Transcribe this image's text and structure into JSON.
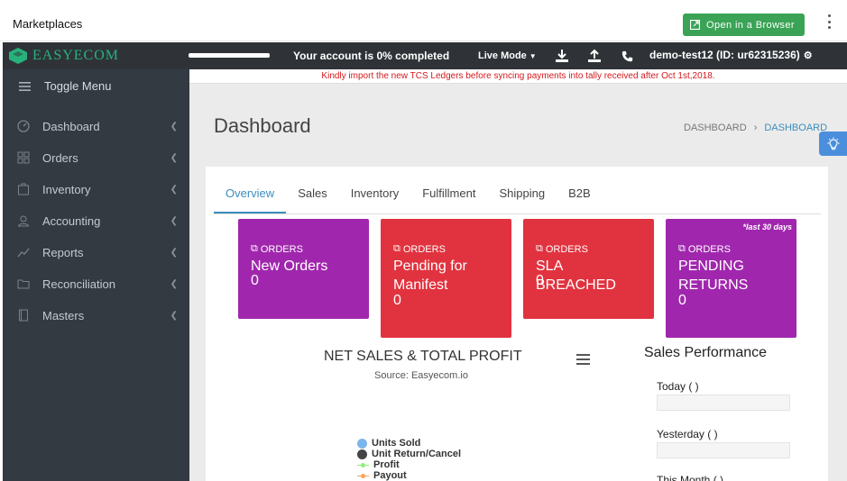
{
  "outer": {
    "title": "Marketplaces",
    "open_button": "Open in a Browser"
  },
  "topbar": {
    "brand": "EASYECOM",
    "completion": "Your account is 0% completed",
    "completion_percent": 0,
    "mode": "Live Mode",
    "account": "demo-test12 (ID: ur62315236)"
  },
  "notice": "Kindly import the new TCS Ledgers before syncing payments into tally received after Oct 1st,2018.",
  "sidebar": {
    "toggle": "Toggle Menu",
    "items": [
      {
        "label": "Dashboard",
        "icon": "gauge-icon"
      },
      {
        "label": "Orders",
        "icon": "grid-icon"
      },
      {
        "label": "Inventory",
        "icon": "box-icon"
      },
      {
        "label": "Accounting",
        "icon": "user-icon"
      },
      {
        "label": "Reports",
        "icon": "chart-line-icon"
      },
      {
        "label": "Reconciliation",
        "icon": "folder-icon"
      },
      {
        "label": "Masters",
        "icon": "book-icon"
      }
    ]
  },
  "page": {
    "title": "Dashboard",
    "breadcrumb": [
      "DASHBOARD",
      "DASHBOARD"
    ]
  },
  "tabs": [
    "Overview",
    "Sales",
    "Inventory",
    "Fulfillment",
    "Shipping",
    "B2B"
  ],
  "cards": [
    {
      "label": "ORDERS",
      "name": "New Orders",
      "value": "0",
      "color": "#a027ad"
    },
    {
      "label": "ORDERS",
      "name": "Pending for Manifest",
      "value": "0",
      "color": "#e1333f"
    },
    {
      "label": "ORDERS",
      "name": "SLA BREACHED",
      "value": "0",
      "color": "#e1333f"
    },
    {
      "label": "ORDERS",
      "name": "PENDING RETURNS",
      "value": "0",
      "color": "#a027ad",
      "note": "*last 30 days"
    }
  ],
  "chart": {
    "title": "NET SALES & TOTAL PROFIT",
    "subtitle": "Source: Easyecom.io",
    "legend": [
      {
        "name": "Units Sold",
        "color": "#7cb5ec",
        "marker": "dot"
      },
      {
        "name": "Unit Return/Cancel",
        "color": "#434348",
        "marker": "dot"
      },
      {
        "name": "Profit",
        "color": "#90ed7d",
        "marker": "line"
      },
      {
        "name": "Payout",
        "color": "#f7a35c",
        "marker": "line"
      }
    ]
  },
  "sales_performance": {
    "title": "Sales Performance",
    "rows": [
      "Today ( )",
      "Yesterday ( )",
      "This Month ( )"
    ]
  },
  "colors": {
    "topbar": "#2f3338",
    "sidebar": "#333a42",
    "brand": "#27b27c",
    "accent": "#3c8dbc",
    "open_button": "#3aa356"
  }
}
